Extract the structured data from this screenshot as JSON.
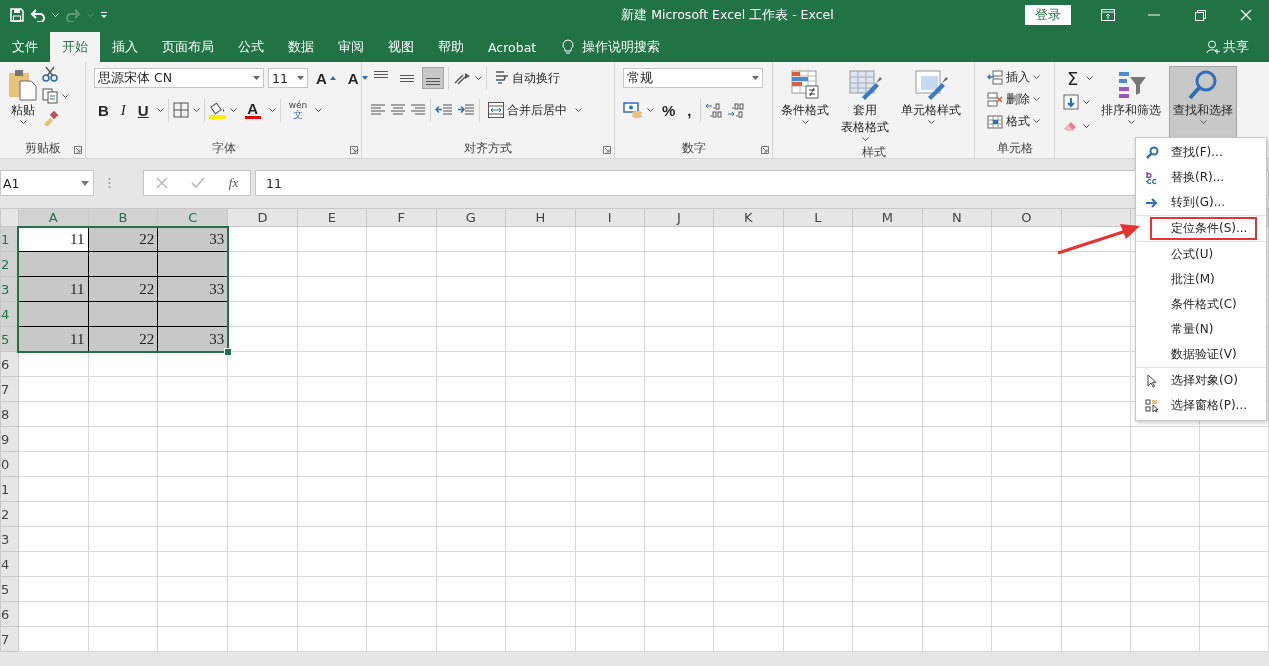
{
  "title_bar": {
    "title": "新建 Microsoft Excel 工作表  -  Excel",
    "sign_in": "登录"
  },
  "tabs": [
    {
      "label": "文件",
      "selected": false
    },
    {
      "label": "开始",
      "selected": true
    },
    {
      "label": "插入",
      "selected": false
    },
    {
      "label": "页面布局",
      "selected": false
    },
    {
      "label": "公式",
      "selected": false
    },
    {
      "label": "数据",
      "selected": false
    },
    {
      "label": "审阅",
      "selected": false
    },
    {
      "label": "视图",
      "selected": false
    },
    {
      "label": "帮助",
      "selected": false
    },
    {
      "label": "Acrobat",
      "selected": false
    }
  ],
  "tell_me": "操作说明搜索",
  "share": "共享",
  "ribbon": {
    "clipboard": {
      "paste": "粘贴",
      "label": "剪贴板"
    },
    "font": {
      "name": "思源宋体 CN",
      "size": "11",
      "grow": "A",
      "shrink": "A",
      "bold": "B",
      "italic": "I",
      "underline": "U",
      "font_color": "A",
      "phonetic": [
        "wén",
        "文"
      ],
      "label": "字体"
    },
    "alignment": {
      "vertical": [
        {
          "selected": false
        },
        {
          "selected": false
        },
        {
          "selected": true
        }
      ],
      "wrap": "自动换行",
      "merge": "合并后居中",
      "label": "对齐方式"
    },
    "number": {
      "format": "常规",
      "percent": "%",
      "comma": ",",
      "label": "数字"
    },
    "styles": {
      "buttons": [
        {
          "lines": [
            "条件格式"
          ]
        },
        {
          "lines": [
            "套用",
            "表格格式"
          ]
        },
        {
          "lines": [
            "单元格样式"
          ]
        }
      ],
      "label": "样式"
    },
    "cells": {
      "buttons": [
        {
          "label": "插入"
        },
        {
          "label": "删除"
        },
        {
          "label": "格式"
        }
      ],
      "label": "单元格"
    },
    "editing": {
      "autosum": "Σ",
      "buttons": [
        {
          "label": "排序和筛选",
          "selected": false
        },
        {
          "label": "查找和选择",
          "selected": true
        }
      ]
    }
  },
  "formula_bar": {
    "name_box": "A1",
    "fx": "fx",
    "value": "11"
  },
  "sheet": {
    "columns": [
      {
        "label": "A",
        "selected": true
      },
      {
        "label": "B",
        "selected": true
      },
      {
        "label": "C",
        "selected": true
      },
      {
        "label": "D",
        "selected": false
      },
      {
        "label": "E",
        "selected": false
      },
      {
        "label": "F",
        "selected": false
      },
      {
        "label": "G",
        "selected": false
      },
      {
        "label": "H",
        "selected": false
      },
      {
        "label": "I",
        "selected": false
      },
      {
        "label": "J",
        "selected": false
      },
      {
        "label": "K",
        "selected": false
      },
      {
        "label": "L",
        "selected": false
      },
      {
        "label": "M",
        "selected": false
      },
      {
        "label": "N",
        "selected": false
      },
      {
        "label": "O",
        "selected": false
      }
    ],
    "rows": [
      {
        "label": "1",
        "selected": true,
        "cells": [
          {
            "value": "11",
            "active": true
          },
          {
            "value": "22",
            "active": false
          },
          {
            "value": "33",
            "active": false
          }
        ]
      },
      {
        "label": "2",
        "selected": true,
        "cells": [
          {
            "active": false
          },
          {
            "active": false
          },
          {
            "active": false
          }
        ]
      },
      {
        "label": "3",
        "selected": true,
        "cells": [
          {
            "value": "11",
            "active": false
          },
          {
            "value": "22",
            "active": false
          },
          {
            "value": "33",
            "active": false
          }
        ]
      },
      {
        "label": "4",
        "selected": true,
        "cells": [
          {
            "active": false
          },
          {
            "active": false
          },
          {
            "active": false
          }
        ]
      },
      {
        "label": "5",
        "selected": true,
        "cells": [
          {
            "value": "11",
            "active": false
          },
          {
            "value": "22",
            "active": false
          },
          {
            "value": "33",
            "active": false
          }
        ]
      },
      {
        "label": "6",
        "selected": false
      },
      {
        "label": "7",
        "selected": false
      },
      {
        "label": "8",
        "selected": false
      },
      {
        "label": "9",
        "selected": false
      },
      {
        "label": "0",
        "selected": false
      },
      {
        "label": "1",
        "selected": false
      },
      {
        "label": "2",
        "selected": false
      },
      {
        "label": "3",
        "selected": false
      },
      {
        "label": "4",
        "selected": false
      },
      {
        "label": "5",
        "selected": false
      },
      {
        "label": "6",
        "selected": false
      },
      {
        "label": "7",
        "selected": false
      }
    ]
  },
  "find_menu": [
    {
      "label": "查找(F)...",
      "separator_before": false,
      "annotated": false
    },
    {
      "label": "替换(R)...",
      "separator_before": false,
      "annotated": false
    },
    {
      "label": "转到(G)...",
      "separator_before": false,
      "annotated": false
    },
    {
      "label": "定位条件(S)...",
      "separator_before": true,
      "annotated": true
    },
    {
      "label": "公式(U)",
      "separator_before": true,
      "annotated": false
    },
    {
      "label": "批注(M)",
      "separator_before": false,
      "annotated": false
    },
    {
      "label": "条件格式(C)",
      "separator_before": false,
      "annotated": false
    },
    {
      "label": "常量(N)",
      "separator_before": false,
      "annotated": false
    },
    {
      "label": "数据验证(V)",
      "separator_before": false,
      "annotated": false
    },
    {
      "label": "选择对象(O)",
      "separator_before": true,
      "annotated": false
    },
    {
      "label": "选择窗格(P)...",
      "separator_before": false,
      "annotated": false
    }
  ]
}
